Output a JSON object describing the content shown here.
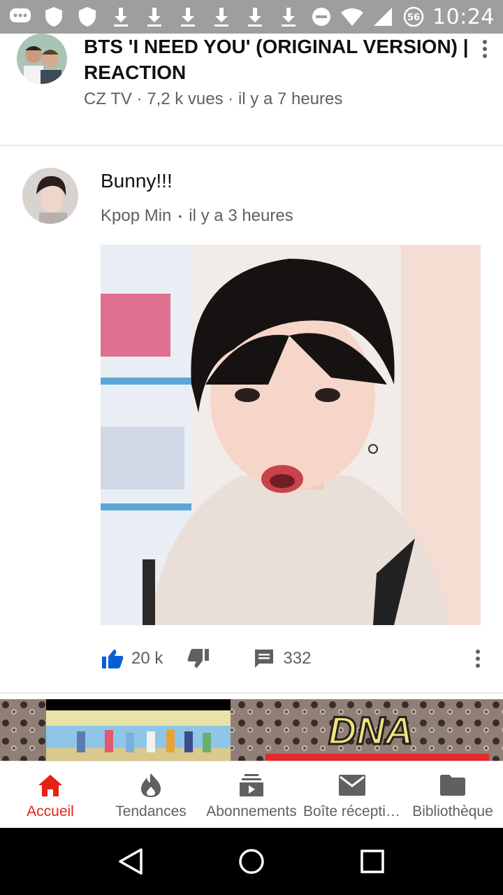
{
  "status_bar": {
    "time": "10:24",
    "badge": "56",
    "icons": [
      "chat-icon",
      "shield-icon",
      "shield-icon",
      "download-icon",
      "download-icon",
      "download-icon",
      "download-icon",
      "download-icon",
      "download-icon",
      "do-not-disturb-icon",
      "wifi-icon",
      "signal-icon",
      "data-badge-icon"
    ]
  },
  "video": {
    "title": "BTS 'I NEED YOU' (ORIGINAL VERSION) | REACTION",
    "meta": "CZ TV · 7,2 k vues · il y a 7 heures"
  },
  "post": {
    "text": "Bunny!!!",
    "author": "Kpop Min",
    "separator": "•",
    "time": "il y a 3 heures",
    "likes": "20 k",
    "comments": "332"
  },
  "thumbnail": {
    "text": "DNA"
  },
  "bottom_nav": {
    "items": [
      {
        "label": "Accueil",
        "icon": "home-icon",
        "active": true
      },
      {
        "label": "Tendances",
        "icon": "flame-icon",
        "active": false
      },
      {
        "label": "Abonnements",
        "icon": "subscriptions-icon",
        "active": false
      },
      {
        "label": "Boîte réception",
        "icon": "mail-icon",
        "active": false
      },
      {
        "label": "Bibliothèque",
        "icon": "folder-icon",
        "active": false
      }
    ]
  },
  "colors": {
    "accent_red": "#e62117",
    "like_blue": "#065fd4",
    "status_bar": "#9e9e9e",
    "secondary_text": "#606060"
  }
}
